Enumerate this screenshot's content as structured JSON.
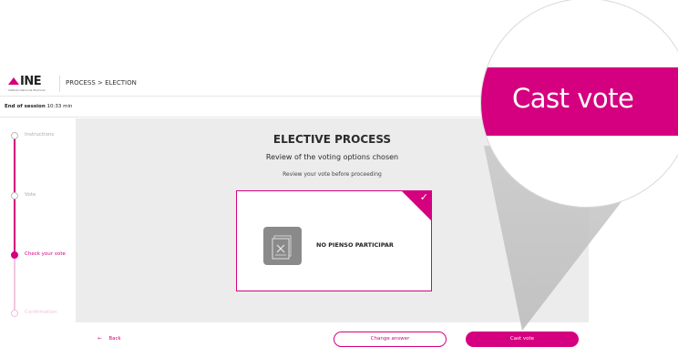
{
  "header": {
    "logo_text": "INE",
    "logo_subtitle": "Instituto Nacional Electoral",
    "breadcrumb": "PROCESS > ELECTION"
  },
  "session": {
    "label": "End of session",
    "time": "10:33 min"
  },
  "steps": [
    {
      "label": "Instructions",
      "state": "done"
    },
    {
      "label": "Vote",
      "state": "done"
    },
    {
      "label": "Check your vote",
      "state": "active"
    },
    {
      "label": "Confirmation",
      "state": "pending"
    }
  ],
  "main": {
    "title": "ELECTIVE PROCESS",
    "subtitle": "Review of the voting options chosen",
    "hint": "Review your vote before proceeding"
  },
  "option": {
    "label": "NO PIENSO PARTICIPAR",
    "icon": "ballot-cancel-icon",
    "selected": true
  },
  "footer": {
    "back_label": "Back",
    "change_label": "Change answer",
    "cast_label": "Cast vote"
  },
  "zoom": {
    "label": "Cast vote"
  },
  "colors": {
    "accent": "#d5007f",
    "content_bg": "#ececec"
  }
}
